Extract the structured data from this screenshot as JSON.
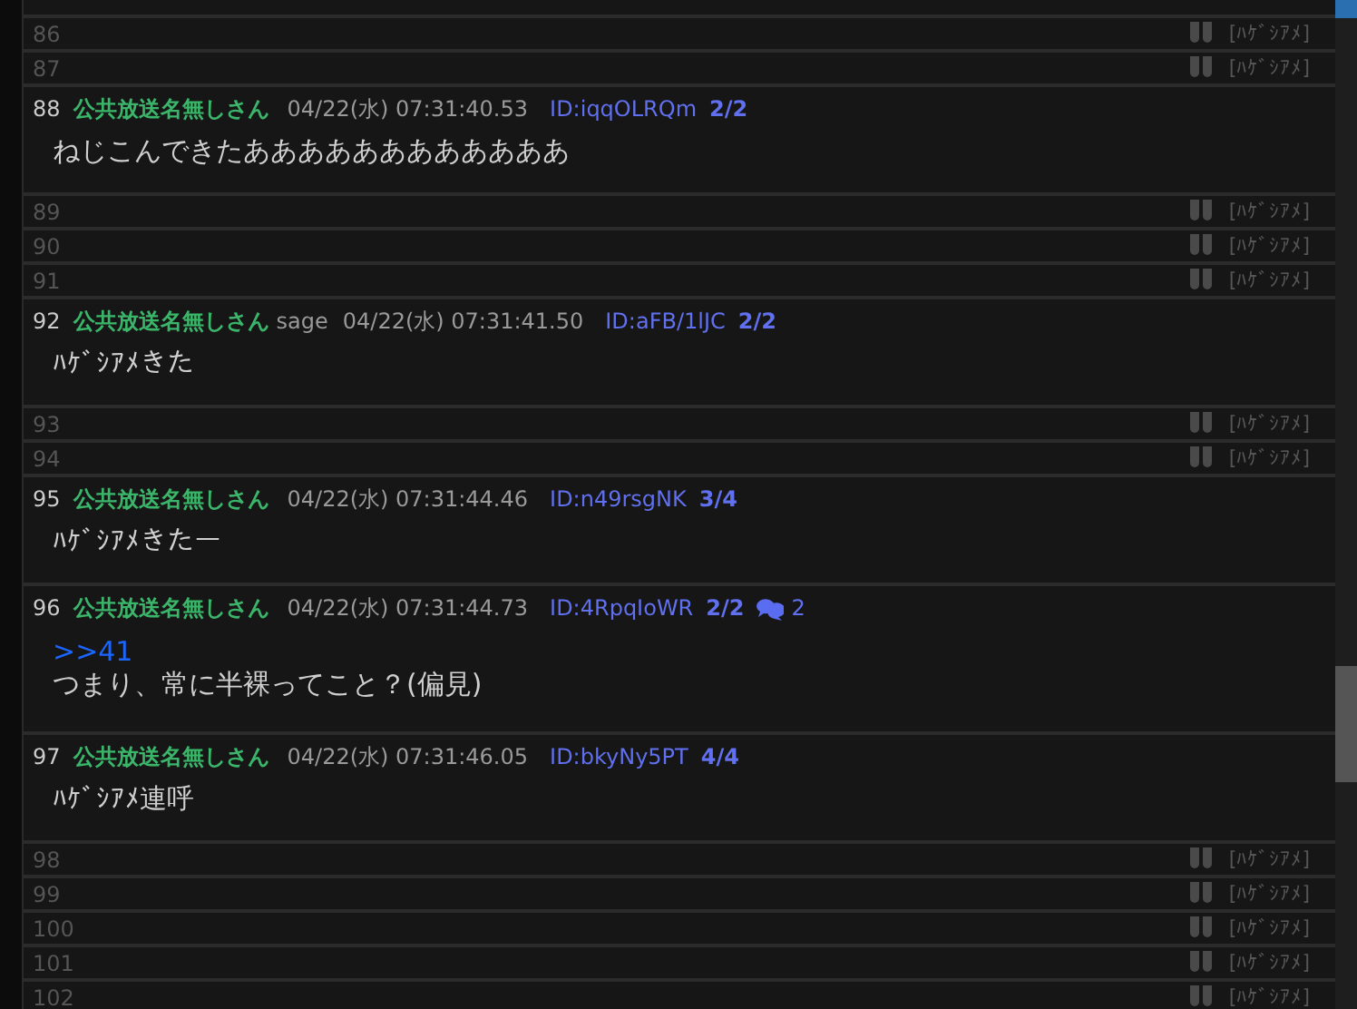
{
  "posts": [
    {
      "kind": "collapsed",
      "number": "86",
      "ng_label": "[ﾊｹﾞｼｱﾒ]"
    },
    {
      "kind": "collapsed",
      "number": "87",
      "ng_label": "[ﾊｹﾞｼｱﾒ]"
    },
    {
      "kind": "full",
      "number": "88",
      "name": "公共放送名無しさん",
      "date": "04/22(水) 07:31:40.53",
      "id": "ID:iqqOLRQm",
      "id_count": "2/2",
      "body": "ねじこんできたああああああああああああ"
    },
    {
      "kind": "collapsed",
      "number": "89",
      "ng_label": "[ﾊｹﾞｼｱﾒ]"
    },
    {
      "kind": "collapsed",
      "number": "90",
      "ng_label": "[ﾊｹﾞｼｱﾒ]"
    },
    {
      "kind": "collapsed",
      "number": "91",
      "ng_label": "[ﾊｹﾞｼｱﾒ]"
    },
    {
      "kind": "full",
      "number": "92",
      "name": "公共放送名無しさん",
      "mail": "sage",
      "date": "04/22(水) 07:31:41.50",
      "id": "ID:aFB/1lJC",
      "id_count": "2/2",
      "body": "ﾊｹﾞｼｱﾒきた"
    },
    {
      "kind": "collapsed",
      "number": "93",
      "ng_label": "[ﾊｹﾞｼｱﾒ]"
    },
    {
      "kind": "collapsed",
      "number": "94",
      "ng_label": "[ﾊｹﾞｼｱﾒ]"
    },
    {
      "kind": "full",
      "number": "95",
      "name": "公共放送名無しさん",
      "date": "04/22(水) 07:31:44.46",
      "id": "ID:n49rsgNK",
      "id_count": "3/4",
      "body": "ﾊｹﾞｼｱﾒきたー"
    },
    {
      "kind": "full",
      "number": "96",
      "name": "公共放送名無しさん",
      "date": "04/22(水) 07:31:44.73",
      "id": "ID:4RpqIoWR",
      "id_count": "2/2",
      "replies": "2",
      "anchor": ">>41",
      "body": "つまり、常に半裸ってこと？(偏見)"
    },
    {
      "kind": "full",
      "number": "97",
      "name": "公共放送名無しさん",
      "date": "04/22(水) 07:31:46.05",
      "id": "ID:bkyNy5PT",
      "id_count": "4/4",
      "body": "ﾊｹﾞｼｱﾒ連呼"
    },
    {
      "kind": "collapsed",
      "number": "98",
      "ng_label": "[ﾊｹﾞｼｱﾒ]"
    },
    {
      "kind": "collapsed",
      "number": "99",
      "ng_label": "[ﾊｹﾞｼｱﾒ]"
    },
    {
      "kind": "collapsed",
      "number": "100",
      "ng_label": "[ﾊｹﾞｼｱﾒ]"
    },
    {
      "kind": "collapsed",
      "number": "101",
      "ng_label": "[ﾊｹﾞｼｱﾒ]"
    },
    {
      "kind": "collapsed",
      "number": "102",
      "ng_label": "[ﾊｹﾞｼｱﾒ]"
    }
  ]
}
